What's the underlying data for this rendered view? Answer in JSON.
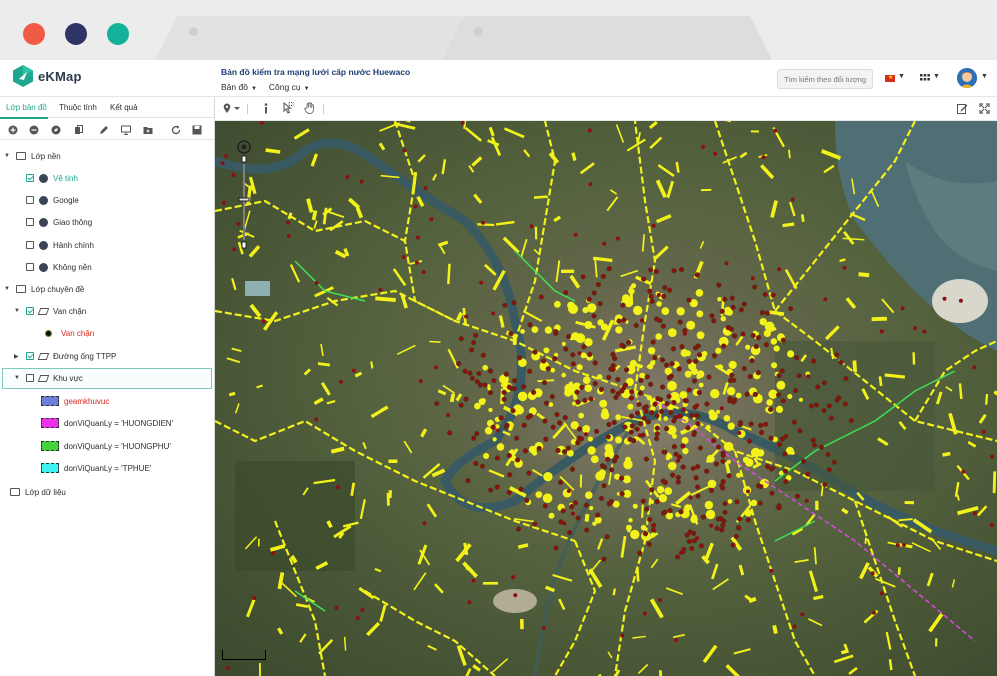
{
  "app": {
    "brand": "eKMap",
    "title": "Bản đồ kiểm tra mạng lưới cấp nước Huewaco",
    "menu": [
      {
        "label": "Bản đồ"
      },
      {
        "label": "Công cụ"
      }
    ],
    "search_placeholder": "Tìm kiếm theo đối tượng"
  },
  "panel": {
    "tabs": [
      "Lớp bản đồ",
      "Thuộc tính",
      "Kết quả"
    ],
    "tree": {
      "base": {
        "label": "Lớp nền",
        "items": [
          "Vệ tinh",
          "Google",
          "Giao thông",
          "Hành chính",
          "Không nền"
        ]
      },
      "thematic": {
        "label": "Lớp chuyên đề",
        "van": "Van chặn",
        "van_legend": "Van chặn",
        "pipe": "Đường ống TTPP",
        "area": "Khu vực",
        "area_legend": [
          {
            "label": "geamkhuvuc",
            "color": "#6f7fd8"
          },
          {
            "label": "donViQuanLy = 'HUONGDIEN'",
            "color": "#ee2fee"
          },
          {
            "label": "donViQuanLy = 'HUONGPHU'",
            "color": "#43d43d"
          },
          {
            "label": "donViQuanLy = 'TPHUE'",
            "color": "#3ff2f2"
          }
        ]
      },
      "data": {
        "label": "Lớp dữ liệu"
      }
    }
  },
  "colors": {
    "accent": "#1ea78d",
    "pipe": "#f2f21a",
    "valve": "#8b1010"
  }
}
